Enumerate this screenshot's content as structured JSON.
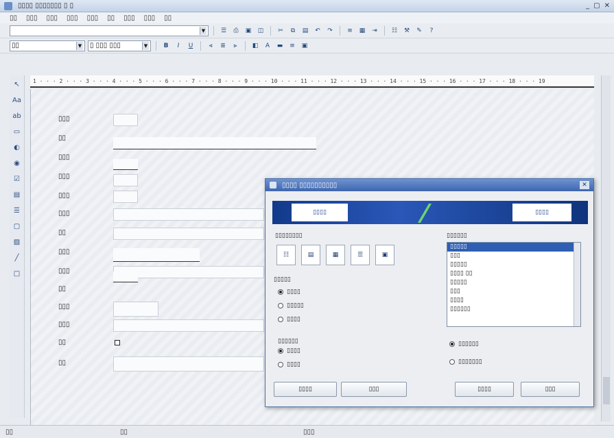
{
  "window": {
    "title": "▯▯▯▯ ▯▯▯▯▯▯▯ ▯ ▯",
    "controls": [
      "_",
      "▢",
      "✕"
    ]
  },
  "menu": [
    "▯▯",
    "▯▯▯",
    "▯▯▯",
    "▯▯▯",
    "▯▯▯",
    "▯▯",
    "▯▯▯",
    "▯▯▯",
    "▯▯"
  ],
  "toolbar1": {
    "object_combo": ""
  },
  "toolbar2": {
    "font_combo": "▯▯",
    "size_combo": "▯ ▯▯▯ ▯▯▯"
  },
  "ruler": {
    "text": "1 · · · 2 · · · 3 · · · 4 · · · 5 · · · 6 · · · 7 · · · 8 · · · 9 · · · 10 · · · 11 · · · 12 · · · 13 · · · 14 · · · 15 · · · 16 · · · 17 · · · 18 · · · 19"
  },
  "form": {
    "labels": [
      "▯▯▯",
      "▯▯",
      "▯▯▯",
      "▯▯▯",
      "▯▯▯",
      "▯▯▯",
      "▯▯",
      "▯▯▯",
      "▯▯▯",
      "▯▯",
      "▯▯▯",
      "▯▯▯",
      "▯▯",
      "▯▯"
    ]
  },
  "dialog": {
    "title": "▯▯▯▯ ▯▯▯▯▯▯▯▯▯▯",
    "banner_left": "▯▯▯▯",
    "banner_right": "▯▯▯▯",
    "layout_label": "▯▯▯▯▯▯▯▯",
    "style_label": "▯▯▯▯▯",
    "list_label": "▯▯▯▯▯▯",
    "list_items": [
      "▯▯▯▯▯",
      "▯▯▯",
      "▯▯▯▯▯",
      "▯▯▯▯ ▯▯",
      "▯▯▯▯▯",
      "▯▯▯",
      "▯▯▯▯",
      "▯▯▯▯▯▯"
    ],
    "radios_left": [
      "▯▯▯▯",
      "▯▯▯▯▯",
      "▯▯▯▯"
    ],
    "option_label": "▯▯▯▯▯▯",
    "radios_bottom": [
      "▯▯▯▯",
      "▯▯▯▯"
    ],
    "radios_right": [
      "▯▯▯▯▯▯",
      "▯▯▯▯▯▯▯"
    ],
    "buttons": [
      "▯▯▯▯",
      "▯▯▯",
      "▯▯▯▯",
      "▯▯▯"
    ]
  },
  "status": {
    "left": "▯▯",
    "mid": "▯▯",
    "right": "▯▯▯"
  }
}
